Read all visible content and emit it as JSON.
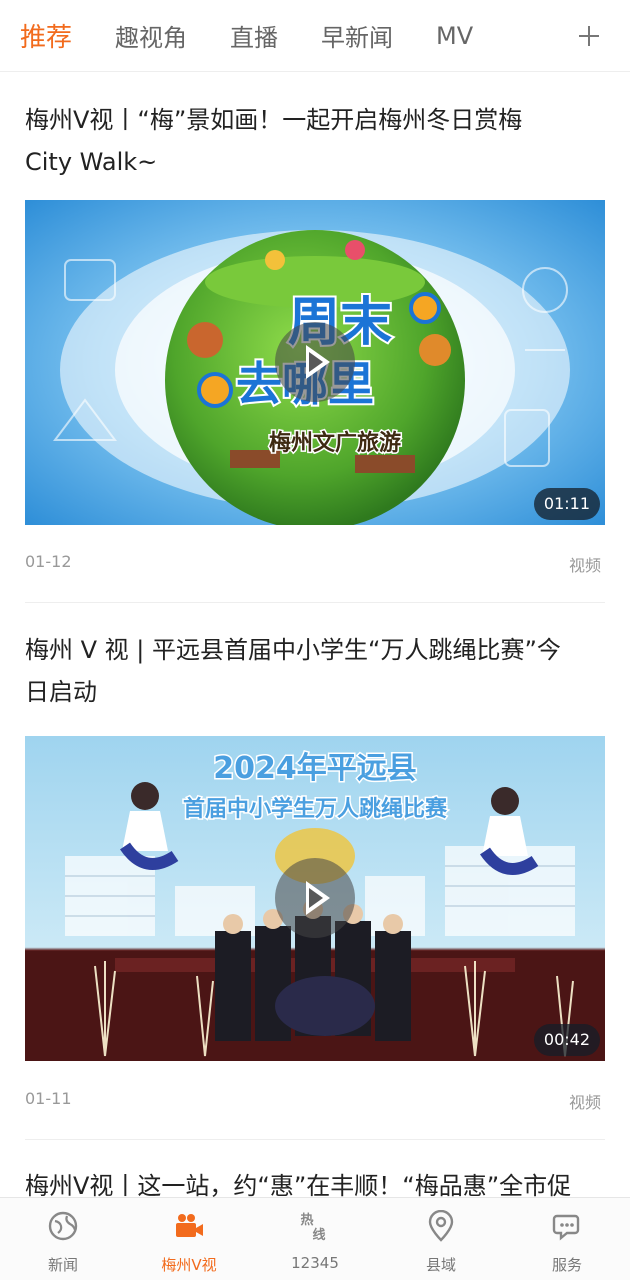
{
  "top_tabs": {
    "items": [
      {
        "label": "推荐",
        "active": true
      },
      {
        "label": "趣视角"
      },
      {
        "label": "直播"
      },
      {
        "label": "早新闻"
      },
      {
        "label": "MV"
      }
    ],
    "add_icon": "plus-icon"
  },
  "feed": {
    "articles": [
      {
        "title_line1": "梅州V视丨“梅”景如画！一起开启梅州冬日赏梅",
        "title_line2": "City Walk~",
        "duration": "01:11",
        "date": "01-12",
        "type": "视频",
        "thumb_text_main1": "周末",
        "thumb_text_main2": "去哪里",
        "thumb_text_sub": "梅州文广旅游"
      },
      {
        "title_line1": "梅州 V 视 |  平远县首届中小学生“万人跳绳比赛”今",
        "title_line2": "日启动",
        "duration": "00:42",
        "date": "01-11",
        "type": "视频",
        "thumb_banner1": "2024年平远县",
        "thumb_banner2": "首届中小学生万人跳绳比赛"
      },
      {
        "title_line1": "梅州V视丨这一站，约“惠”在丰顺！“梅品惠”全市促"
      }
    ]
  },
  "bottom_nav": {
    "items": [
      {
        "label": "新闻",
        "icon": "globe-icon"
      },
      {
        "label": "梅州V视",
        "icon": "video-camera-icon",
        "active": true
      },
      {
        "label": "12345",
        "icon": "hotline-icon",
        "icon_text1": "热",
        "icon_text2": "线"
      },
      {
        "label": "县域",
        "icon": "location-pin-icon"
      },
      {
        "label": "服务",
        "icon": "chat-bubble-icon"
      }
    ]
  },
  "colors": {
    "accent": "#f26b1d",
    "text": "#222222",
    "meta": "#999999"
  }
}
